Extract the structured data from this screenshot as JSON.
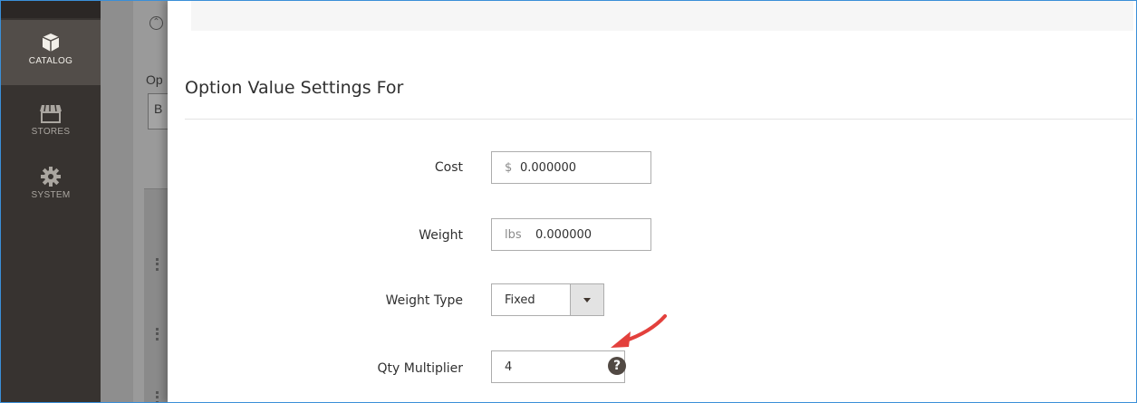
{
  "nav": {
    "items": [
      {
        "label": "CATALOG",
        "icon": "box-icon",
        "active": true
      },
      {
        "label": "STORES",
        "icon": "store-icon",
        "active": false
      },
      {
        "label": "SYSTEM",
        "icon": "gear-icon",
        "active": false
      }
    ]
  },
  "background_page": {
    "section_label": "Op",
    "field_value": "B"
  },
  "modal": {
    "title": "Option Value Settings For",
    "fields": {
      "cost": {
        "label": "Cost",
        "addon": "$",
        "value": "0.000000"
      },
      "weight": {
        "label": "Weight",
        "addon": "lbs",
        "value": "0.000000"
      },
      "weight_type": {
        "label": "Weight Type",
        "value": "Fixed"
      },
      "qty_multiplier": {
        "label": "Qty Multiplier",
        "value": "4",
        "help_icon": "question-icon"
      }
    }
  },
  "colors": {
    "nav_bg": "#373330",
    "nav_active": "#524d49",
    "annotation_arrow": "#e3403c"
  }
}
